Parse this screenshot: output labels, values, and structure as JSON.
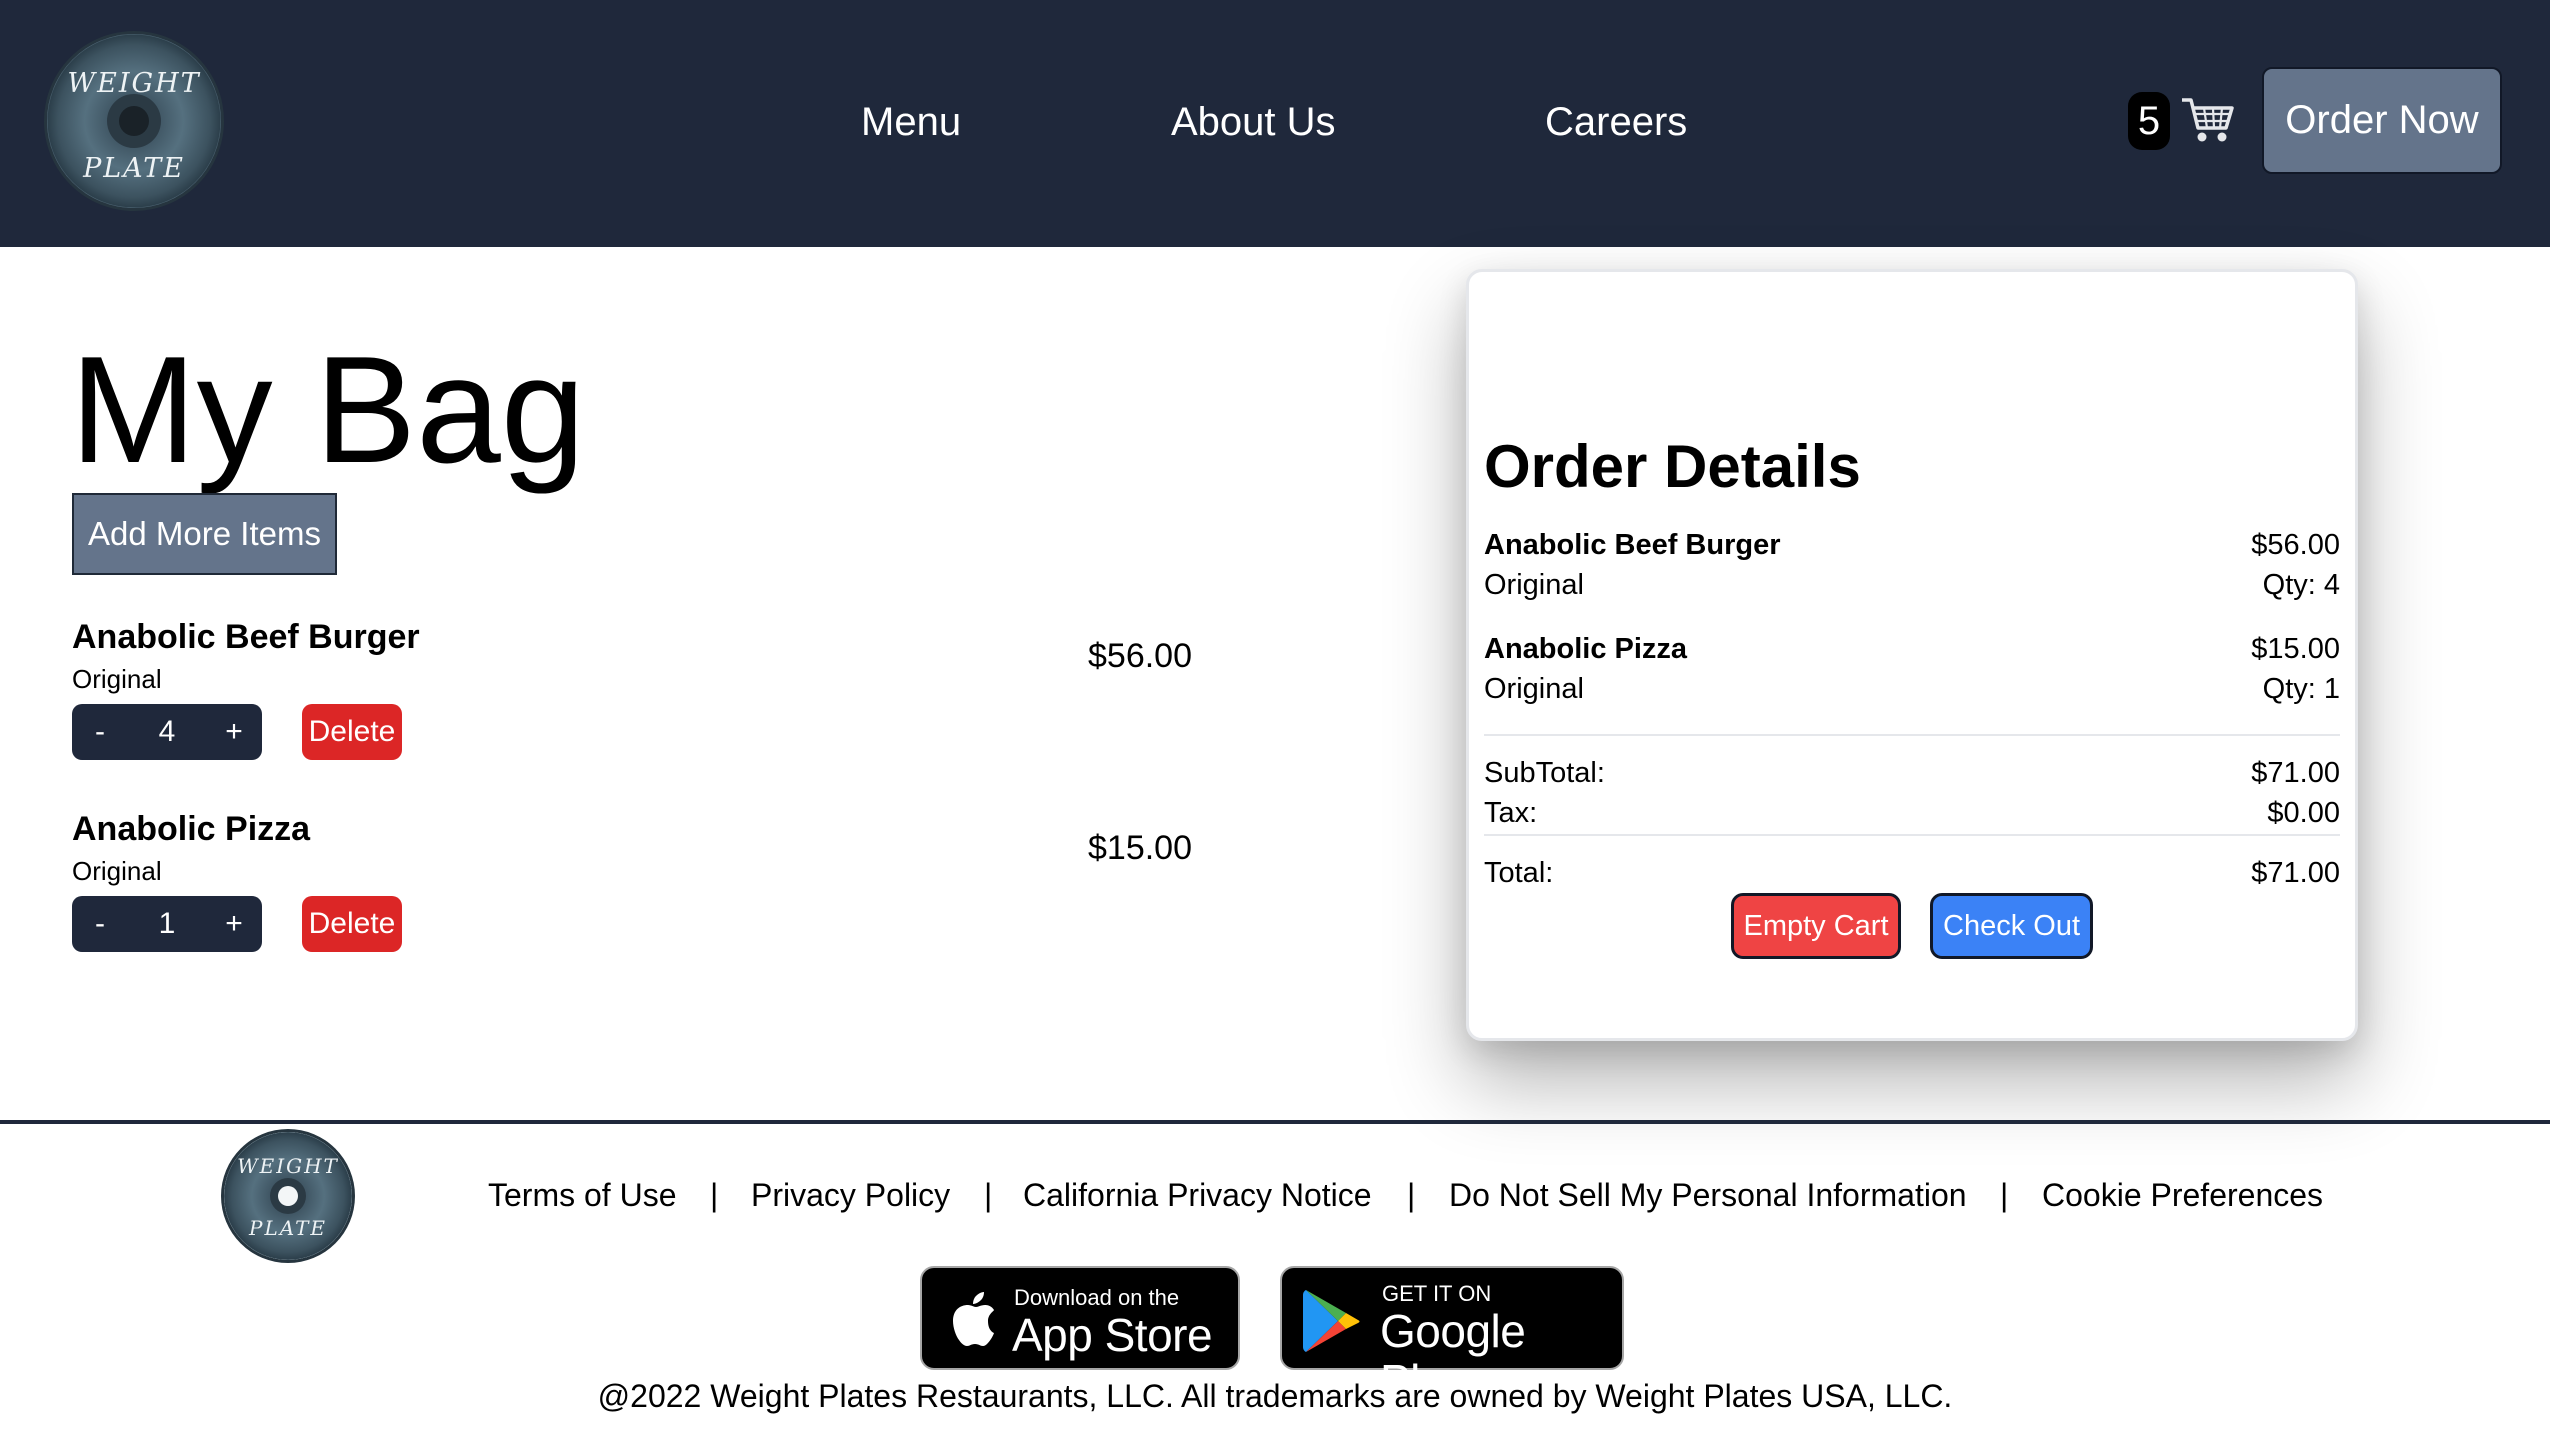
{
  "header": {
    "logo_text": [
      "WEIGHT",
      "PLATE"
    ],
    "nav": [
      "Menu",
      "About Us",
      "Careers"
    ],
    "cart_count": "5",
    "order_now": "Order Now"
  },
  "bag": {
    "title": "My Bag",
    "add_more": "Add More Items",
    "items": [
      {
        "name": "Anabolic Beef Burger",
        "variant": "Original",
        "qty": "4",
        "price": "$56.00",
        "minus": "-",
        "plus": "+",
        "delete": "Delete"
      },
      {
        "name": "Anabolic Pizza",
        "variant": "Original",
        "qty": "1",
        "price": "$15.00",
        "minus": "-",
        "plus": "+",
        "delete": "Delete"
      }
    ]
  },
  "order_details": {
    "title": "Order Details",
    "lines": [
      {
        "name": "Anabolic Beef Burger",
        "variant": "Original",
        "price": "$56.00",
        "qty": "Qty: 4"
      },
      {
        "name": "Anabolic Pizza",
        "variant": "Original",
        "price": "$15.00",
        "qty": "Qty: 1"
      }
    ],
    "subtotal_label": "SubTotal:",
    "subtotal": "$71.00",
    "tax_label": "Tax:",
    "tax": "$0.00",
    "total_label": "Total:",
    "total": "$71.00",
    "empty_cart": "Empty Cart",
    "check_out": "Check Out"
  },
  "footer": {
    "logo_text": [
      "WEIGHT",
      "PLATE"
    ],
    "links": [
      "Terms of Use",
      "Privacy Policy",
      "California Privacy Notice",
      "Do Not Sell My Personal Information",
      "Cookie Preferences"
    ],
    "separator": "|",
    "app_store": {
      "small": "Download on the",
      "big": "App Store"
    },
    "google_play": {
      "small": "GET IT ON",
      "big": "Google Play"
    },
    "copyright": "@2022 Weight Plates Restaurants, LLC. All trademarks are owned by Weight Plates USA, LLC."
  }
}
